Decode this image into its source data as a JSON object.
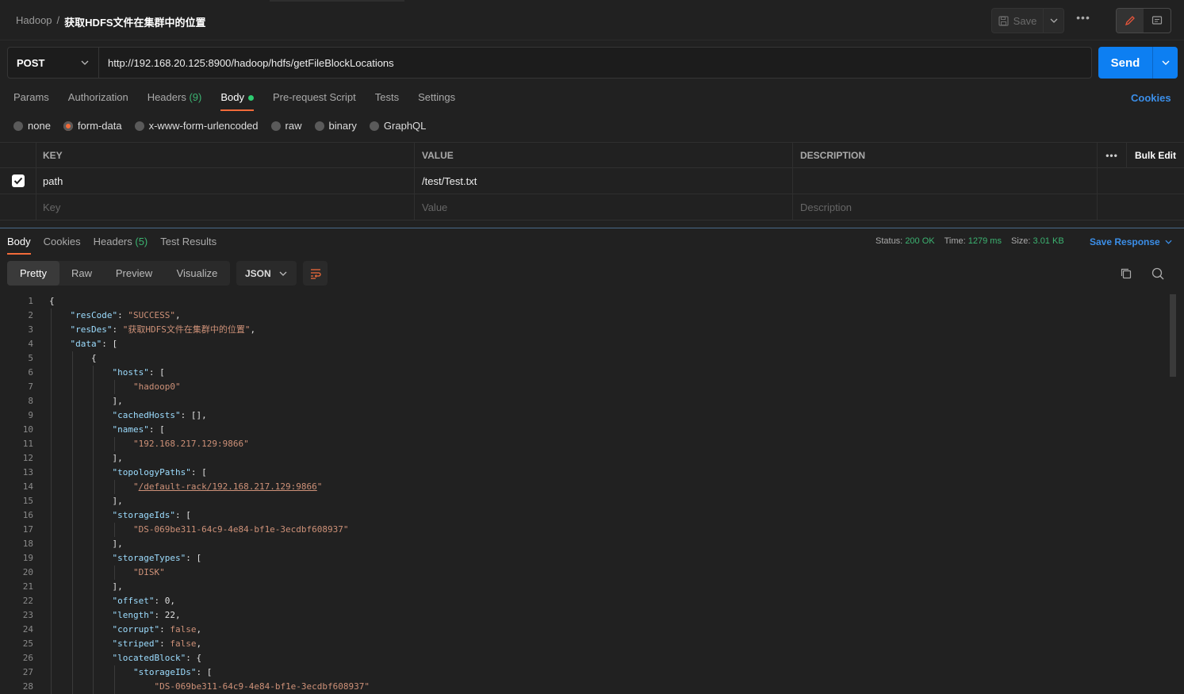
{
  "header": {
    "breadcrumb_parent": "Hadoop",
    "breadcrumb_sep": "/",
    "request_name": "获取HDFS文件在集群中的位置",
    "save_label": "Save"
  },
  "request": {
    "method": "POST",
    "url": "http://192.168.20.125:8900/hadoop/hdfs/getFileBlockLocations",
    "send_label": "Send"
  },
  "req_tabs": {
    "params": "Params",
    "authorization": "Authorization",
    "headers": "Headers",
    "headers_count": "(9)",
    "body": "Body",
    "prerequest": "Pre-request Script",
    "tests": "Tests",
    "settings": "Settings",
    "cookies": "Cookies"
  },
  "body_types": {
    "none": "none",
    "form_data": "form-data",
    "urlencoded": "x-www-form-urlencoded",
    "raw": "raw",
    "binary": "binary",
    "graphql": "GraphQL",
    "selected": "form-data"
  },
  "kv_table": {
    "col_key": "KEY",
    "col_value": "VALUE",
    "col_description": "DESCRIPTION",
    "bulk_edit": "Bulk Edit",
    "rows": [
      {
        "key": "path",
        "value": "/test/Test.txt",
        "checked": true
      }
    ],
    "placeholder_key": "Key",
    "placeholder_value": "Value",
    "placeholder_description": "Description"
  },
  "res_tabs": {
    "body": "Body",
    "cookies": "Cookies",
    "headers": "Headers",
    "headers_count": "(5)",
    "test_results": "Test Results"
  },
  "res_status": {
    "status_label": "Status:",
    "status_value": "200 OK",
    "time_label": "Time:",
    "time_value": "1279 ms",
    "size_label": "Size:",
    "size_value": "3.01 KB",
    "save_response": "Save Response"
  },
  "view": {
    "pretty": "Pretty",
    "raw": "Raw",
    "preview": "Preview",
    "visualize": "Visualize",
    "format": "JSON"
  },
  "code_lines": [
    {
      "n": "1",
      "indent": 0,
      "parts": [
        [
          "p",
          "{"
        ]
      ]
    },
    {
      "n": "2",
      "indent": 1,
      "parts": [
        [
          "k",
          "\"resCode\""
        ],
        [
          "p",
          ": "
        ],
        [
          "s",
          "\"SUCCESS\""
        ],
        [
          "p",
          ","
        ]
      ]
    },
    {
      "n": "3",
      "indent": 1,
      "parts": [
        [
          "k",
          "\"resDes\""
        ],
        [
          "p",
          ": "
        ],
        [
          "s",
          "\"获取HDFS文件在集群中的位置\""
        ],
        [
          "p",
          ","
        ]
      ]
    },
    {
      "n": "4",
      "indent": 1,
      "parts": [
        [
          "k",
          "\"data\""
        ],
        [
          "p",
          ": ["
        ]
      ]
    },
    {
      "n": "5",
      "indent": 2,
      "parts": [
        [
          "p",
          "{"
        ]
      ]
    },
    {
      "n": "6",
      "indent": 3,
      "parts": [
        [
          "k",
          "\"hosts\""
        ],
        [
          "p",
          ": ["
        ]
      ]
    },
    {
      "n": "7",
      "indent": 4,
      "parts": [
        [
          "s",
          "\"hadoop0\""
        ]
      ]
    },
    {
      "n": "8",
      "indent": 3,
      "parts": [
        [
          "p",
          "],"
        ]
      ]
    },
    {
      "n": "9",
      "indent": 3,
      "parts": [
        [
          "k",
          "\"cachedHosts\""
        ],
        [
          "p",
          ": [],"
        ]
      ]
    },
    {
      "n": "10",
      "indent": 3,
      "parts": [
        [
          "k",
          "\"names\""
        ],
        [
          "p",
          ": ["
        ]
      ]
    },
    {
      "n": "11",
      "indent": 4,
      "parts": [
        [
          "s",
          "\"192.168.217.129:9866\""
        ]
      ]
    },
    {
      "n": "12",
      "indent": 3,
      "parts": [
        [
          "p",
          "],"
        ]
      ]
    },
    {
      "n": "13",
      "indent": 3,
      "parts": [
        [
          "k",
          "\"topologyPaths\""
        ],
        [
          "p",
          ": ["
        ]
      ]
    },
    {
      "n": "14",
      "indent": 4,
      "parts": [
        [
          "s",
          "\""
        ],
        [
          "u",
          "/default-rack/192.168.217.129:9866"
        ],
        [
          "s",
          "\""
        ]
      ]
    },
    {
      "n": "15",
      "indent": 3,
      "parts": [
        [
          "p",
          "],"
        ]
      ]
    },
    {
      "n": "16",
      "indent": 3,
      "parts": [
        [
          "k",
          "\"storageIds\""
        ],
        [
          "p",
          ": ["
        ]
      ]
    },
    {
      "n": "17",
      "indent": 4,
      "parts": [
        [
          "s",
          "\"DS-069be311-64c9-4e84-bf1e-3ecdbf608937\""
        ]
      ]
    },
    {
      "n": "18",
      "indent": 3,
      "parts": [
        [
          "p",
          "],"
        ]
      ]
    },
    {
      "n": "19",
      "indent": 3,
      "parts": [
        [
          "k",
          "\"storageTypes\""
        ],
        [
          "p",
          ": ["
        ]
      ]
    },
    {
      "n": "20",
      "indent": 4,
      "parts": [
        [
          "s",
          "\"DISK\""
        ]
      ]
    },
    {
      "n": "21",
      "indent": 3,
      "parts": [
        [
          "p",
          "],"
        ]
      ]
    },
    {
      "n": "22",
      "indent": 3,
      "parts": [
        [
          "k",
          "\"offset\""
        ],
        [
          "p",
          ": 0,"
        ]
      ]
    },
    {
      "n": "23",
      "indent": 3,
      "parts": [
        [
          "k",
          "\"length\""
        ],
        [
          "p",
          ": 22,"
        ]
      ]
    },
    {
      "n": "24",
      "indent": 3,
      "parts": [
        [
          "k",
          "\"corrupt\""
        ],
        [
          "p",
          ": "
        ],
        [
          "b",
          "false"
        ],
        [
          "p",
          ","
        ]
      ]
    },
    {
      "n": "25",
      "indent": 3,
      "parts": [
        [
          "k",
          "\"striped\""
        ],
        [
          "p",
          ": "
        ],
        [
          "b",
          "false"
        ],
        [
          "p",
          ","
        ]
      ]
    },
    {
      "n": "26",
      "indent": 3,
      "parts": [
        [
          "k",
          "\"locatedBlock\""
        ],
        [
          "p",
          ": {"
        ]
      ]
    },
    {
      "n": "27",
      "indent": 4,
      "parts": [
        [
          "k",
          "\"storageIDs\""
        ],
        [
          "p",
          ": ["
        ]
      ]
    },
    {
      "n": "28",
      "indent": 5,
      "parts": [
        [
          "s",
          "\"DS-069be311-64c9-4e84-bf1e-3ecdbf608937\""
        ]
      ]
    }
  ],
  "colors": {
    "accent": "#f26b3a",
    "primary": "#0d7ff2",
    "success": "#3cb371",
    "json_key": "#9cdcfe",
    "json_string": "#ce9178"
  }
}
